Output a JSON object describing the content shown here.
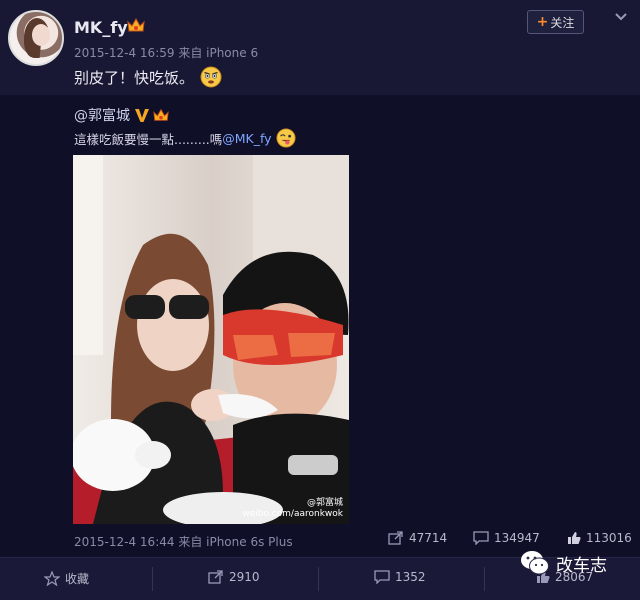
{
  "post": {
    "username": "MK_fy",
    "meta": "2015-12-4 16:59 来自 iPhone 6",
    "text": "别皮了！快吃饭。",
    "follow_label": "关注"
  },
  "repost": {
    "username": "@郭富城",
    "text_before": "這樣吃飯要慢一點.........嗎",
    "mention": "@MK_fy",
    "meta": "2015-12-4 16:44 来自 iPhone 6s Plus",
    "photo_watermark_name": "@郭富城",
    "photo_watermark_url": "weibo.com/aaronkwok",
    "stats": {
      "reposts": "47714",
      "comments": "134947",
      "likes": "113016"
    }
  },
  "bottom_bar": {
    "favorite_label": "收藏",
    "reposts": "2910",
    "comments": "1352",
    "likes": "28067"
  },
  "watermark": {
    "label": "改车志"
  },
  "colors": {
    "accent": "#ff8a2a",
    "link": "#7fa6ff",
    "background": "#151530"
  }
}
